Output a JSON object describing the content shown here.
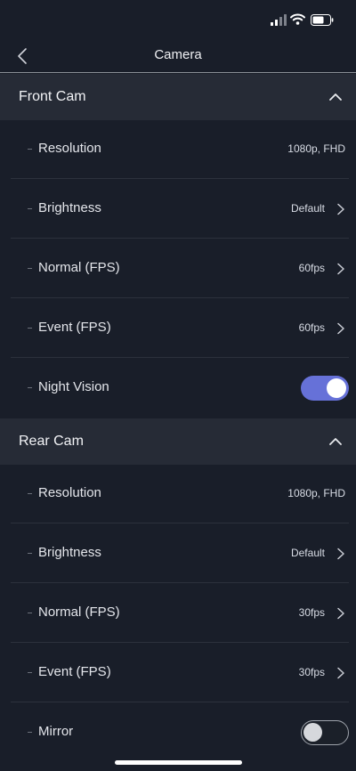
{
  "header": {
    "title": "Camera"
  },
  "front": {
    "title": "Front Cam",
    "resolution": {
      "label": "Resolution",
      "value": "1080p, FHD"
    },
    "brightness": {
      "label": "Brightness",
      "value": "Default"
    },
    "normal_fps": {
      "label": "Normal (FPS)",
      "value": "60fps"
    },
    "event_fps": {
      "label": "Event (FPS)",
      "value": "60fps"
    },
    "night_vision": {
      "label": "Night Vision",
      "on": true
    }
  },
  "rear": {
    "title": "Rear Cam",
    "resolution": {
      "label": "Resolution",
      "value": "1080p, FHD"
    },
    "brightness": {
      "label": "Brightness",
      "value": "Default"
    },
    "normal_fps": {
      "label": "Normal (FPS)",
      "value": "30fps"
    },
    "event_fps": {
      "label": "Event (FPS)",
      "value": "30fps"
    },
    "mirror": {
      "label": "Mirror",
      "on": false
    }
  },
  "colors": {
    "background": "#191e29",
    "section": "#262b36",
    "accent": "#6671d8"
  },
  "icons": [
    "signal-icon",
    "wifi-icon",
    "battery-icon",
    "back-chevron-icon",
    "chevron-up-icon",
    "chevron-right-icon"
  ]
}
